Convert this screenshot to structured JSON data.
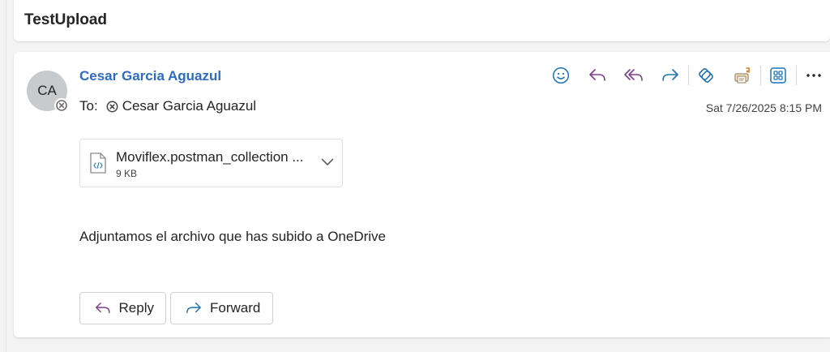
{
  "subject": "TestUpload",
  "message": {
    "avatar_initials": "CA",
    "sender_name": "Cesar Garcia Aguazul",
    "to_label": "To:",
    "recipients": [
      "Cesar Garcia Aguazul"
    ],
    "date": "Sat 7/26/2025 8:15 PM",
    "body": "Adjuntamos el archivo que has subido a OneDrive"
  },
  "attachment": {
    "file_name": "Moviflex.postman_collection ...",
    "file_size": "9 KB"
  },
  "toolbar": {
    "icons": [
      "emoji-icon",
      "reply-icon",
      "reply-all-icon",
      "forward-icon",
      "loop-icon",
      "print-icon",
      "apps-icon",
      "more-icon"
    ]
  },
  "actions": {
    "reply_label": "Reply",
    "forward_label": "Forward"
  },
  "colors": {
    "accent_blue": "#2d6cc0",
    "reply_purple": "#7f3d8d",
    "forward_blue": "#1d73b5"
  }
}
